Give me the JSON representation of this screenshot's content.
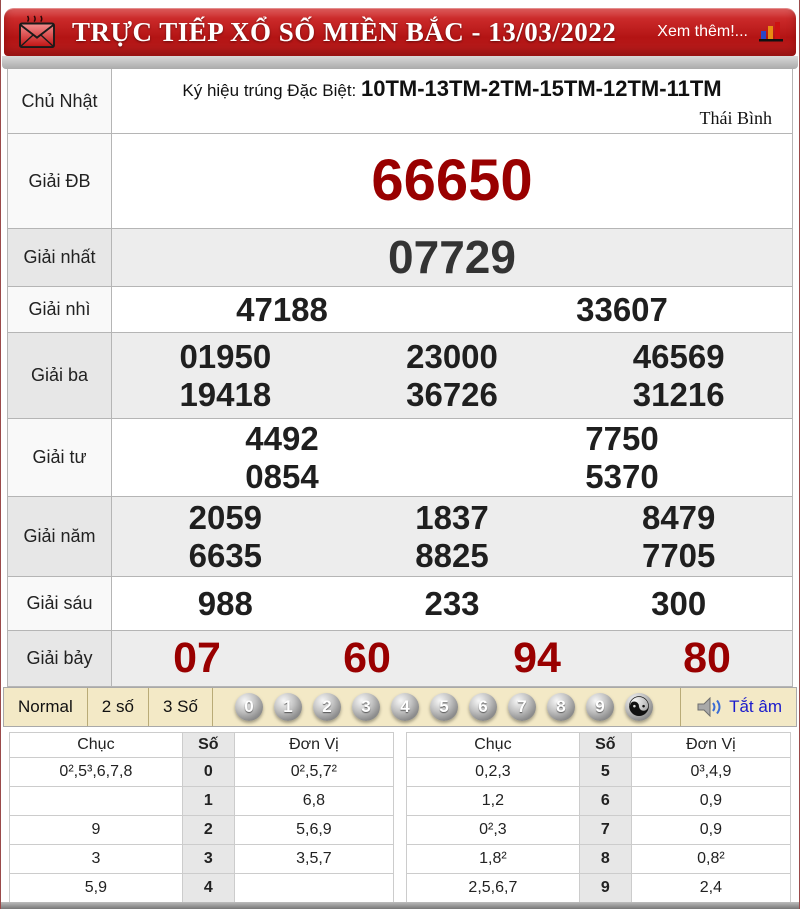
{
  "header": {
    "title": "TRỰC TIẾP XỔ SỐ MIỀN BẮC - 13/03/2022",
    "more_label": "Xem thêm!..."
  },
  "info_row": {
    "day_label": "Chủ Nhật",
    "code_label": "Ký hiệu trúng Đặc Biệt:",
    "code_value": "10TM-13TM-2TM-15TM-12TM-11TM",
    "province": "Thái Bình"
  },
  "prizes": [
    {
      "label": "Giải ĐB",
      "rows": [
        [
          "66650"
        ]
      ]
    },
    {
      "label": "Giải nhất",
      "rows": [
        [
          "07729"
        ]
      ]
    },
    {
      "label": "Giải nhì",
      "rows": [
        [
          "47188",
          "33607"
        ]
      ]
    },
    {
      "label": "Giải ba",
      "rows": [
        [
          "01950",
          "23000",
          "46569"
        ],
        [
          "19418",
          "36726",
          "31216"
        ]
      ]
    },
    {
      "label": "Giải tư",
      "rows": [
        [
          "4492",
          "7750"
        ],
        [
          "0854",
          "5370"
        ]
      ]
    },
    {
      "label": "Giải năm",
      "rows": [
        [
          "2059",
          "1837",
          "8479"
        ],
        [
          "6635",
          "8825",
          "7705"
        ]
      ]
    },
    {
      "label": "Giải sáu",
      "rows": [
        [
          "988",
          "233",
          "300"
        ]
      ]
    },
    {
      "label": "Giải bảy",
      "rows": [
        [
          "07",
          "60",
          "94",
          "80"
        ]
      ]
    }
  ],
  "toolbar": {
    "modes": [
      "Normal",
      "2 số",
      "3 Số"
    ],
    "digits": [
      "0",
      "1",
      "2",
      "3",
      "4",
      "5",
      "6",
      "7",
      "8",
      "9"
    ],
    "yinyang": "☯",
    "mute_label": "Tắt âm"
  },
  "stats_tables": [
    {
      "headers": [
        "Chục",
        "Số",
        "Đơn Vị"
      ],
      "rows": [
        {
          "chuc": "0²,5³,6,7,8",
          "so": "0",
          "donvi": "0²,5,7²"
        },
        {
          "chuc": "",
          "so": "1",
          "donvi": "6,8"
        },
        {
          "chuc": "9",
          "so": "2",
          "donvi": "5,6,9"
        },
        {
          "chuc": "3",
          "so": "3",
          "donvi": "3,5,7"
        },
        {
          "chuc": "5,9",
          "so": "4",
          "donvi": ""
        }
      ]
    },
    {
      "headers": [
        "Chục",
        "Số",
        "Đơn Vị"
      ],
      "rows": [
        {
          "chuc": "0,2,3",
          "so": "5",
          "donvi": "0³,4,9"
        },
        {
          "chuc": "1,2",
          "so": "6",
          "donvi": "0,9"
        },
        {
          "chuc": "0²,3",
          "so": "7",
          "donvi": "0,9"
        },
        {
          "chuc": "1,8²",
          "so": "8",
          "donvi": "0,8²"
        },
        {
          "chuc": "2,5,6,7",
          "so": "9",
          "donvi": "2,4"
        }
      ]
    }
  ],
  "colors": {
    "header_red": "#b31414",
    "prize_red": "#990000",
    "toolbar_beige": "#f3e9c6",
    "link_blue": "#1a1acd"
  }
}
